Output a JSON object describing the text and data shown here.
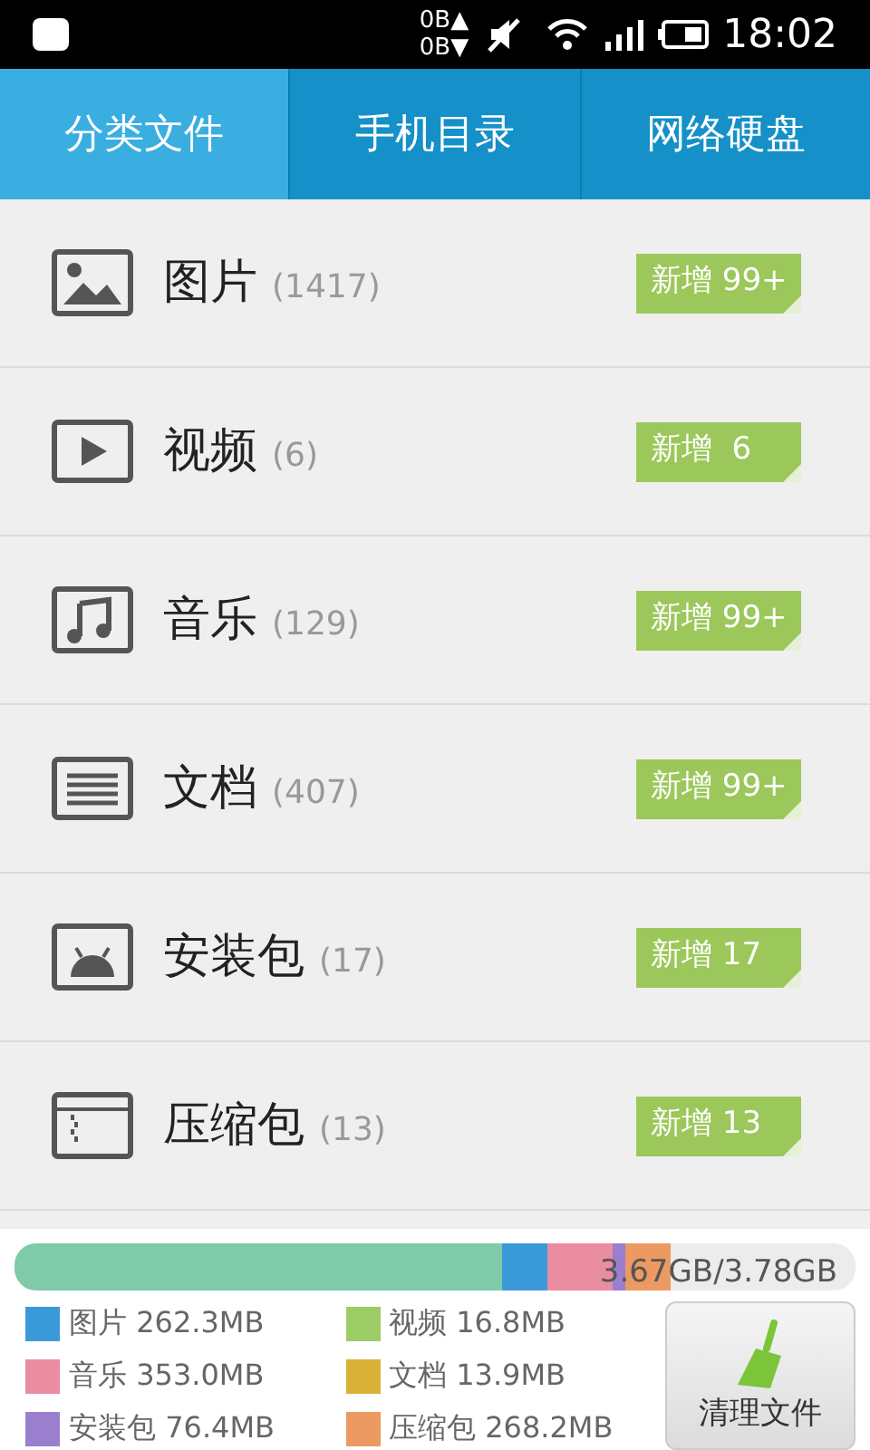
{
  "status_bar": {
    "net_up": "0B▲",
    "net_down": "0B▼",
    "time": "18:02"
  },
  "tabs": [
    {
      "label": "分类文件",
      "selected": true
    },
    {
      "label": "手机目录",
      "selected": false
    },
    {
      "label": "网络硬盘",
      "selected": false
    }
  ],
  "categories": [
    {
      "kind": "image",
      "name": "图片",
      "count": "(1417)",
      "badge": "新增 99+"
    },
    {
      "kind": "video",
      "name": "视频",
      "count": "(6)",
      "badge": "新增  6"
    },
    {
      "kind": "music",
      "name": "音乐",
      "count": "(129)",
      "badge": "新增 99+"
    },
    {
      "kind": "document",
      "name": "文档",
      "count": "(407)",
      "badge": "新增 99+"
    },
    {
      "kind": "apk",
      "name": "安装包",
      "count": "(17)",
      "badge": "新增 17"
    },
    {
      "kind": "archive",
      "name": "压缩包",
      "count": "(13)",
      "badge": "新增 13"
    }
  ],
  "storage": {
    "usage": "3.67GB/3.78GB",
    "segments": [
      {
        "color": "#7ecaa9"
      },
      {
        "color": "#3a9ad9"
      },
      {
        "color": "#ea8da0"
      },
      {
        "color": "#9a7fcf"
      },
      {
        "color": "#ec9a62"
      }
    ],
    "legend": [
      {
        "label": "图片 262.3MB",
        "color": "#3a9ad9"
      },
      {
        "label": "视频 16.8MB",
        "color": "#9ccc65"
      },
      {
        "label": "音乐 353.0MB",
        "color": "#ea8da0"
      },
      {
        "label": "文档 13.9MB",
        "color": "#d8b236"
      },
      {
        "label": "安装包 76.4MB",
        "color": "#9a7fcf"
      },
      {
        "label": "压缩包 268.2MB",
        "color": "#ec9a62"
      }
    ]
  },
  "clean_button": "清理文件"
}
